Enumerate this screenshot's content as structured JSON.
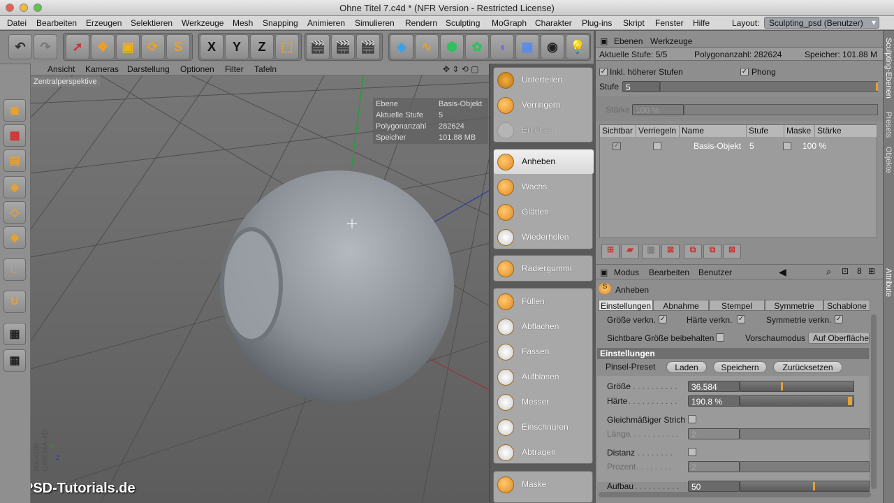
{
  "window": {
    "title": "Ohne Titel 7.c4d * (NFR Version - Restricted License)"
  },
  "menu": [
    "Datei",
    "Bearbeiten",
    "Erzeugen",
    "Selektieren",
    "Werkzeuge",
    "Mesh",
    "Snapping",
    "Animieren",
    "Simulieren",
    "Rendern",
    "Sculpting",
    "MoGraph",
    "Charakter",
    "Plug-ins",
    "Skript",
    "Fenster",
    "Hilfe"
  ],
  "layout": {
    "label": "Layout:",
    "value": "Sculpting_psd (Benutzer)"
  },
  "toolbar": {
    "x": "X",
    "y": "Y",
    "z": "Z"
  },
  "viewport": {
    "menu": [
      "Ansicht",
      "Kameras",
      "Darstellung",
      "Optionen",
      "Filter",
      "Tafeln"
    ],
    "camera": "Zentralperspektive",
    "hud": [
      {
        "k": "Ebene",
        "v": "Basis-Objekt"
      },
      {
        "k": "Aktuelle Stufe",
        "v": "5"
      },
      {
        "k": "Polygonanzahl",
        "v": "282624"
      },
      {
        "k": "Speicher",
        "v": "101.88 MB"
      }
    ],
    "watermark": "PSD-Tutorials.de",
    "brand": "MAXON CINEMA 4D",
    "axis_y": "Y",
    "axis_z": "Z"
  },
  "brushes": {
    "group1": [
      "Unterteilen",
      "Verringern",
      "Erhöhen"
    ],
    "group2": [
      "Anheben",
      "Wachs",
      "Glätten",
      "Wiederholen"
    ],
    "group3": [
      "Radiergummi"
    ],
    "group4": [
      "Füllen",
      "Abflachen",
      "Fassen",
      "Aufblasen",
      "Messer",
      "Einschnüren",
      "Abtragen"
    ],
    "group5": [
      "Maske"
    ]
  },
  "layers": {
    "tabs": [
      "Ebenen",
      "Werkzeuge"
    ],
    "info": {
      "stufe": "Aktuelle Stufe: 5/5",
      "poly": "Polygonanzahl: 282624",
      "mem": "Speicher: 101.88 M"
    },
    "incl": "Inkl. höherer Stufen",
    "phong": "Phong",
    "stufe_label": "Stufe",
    "stufe_value": "5",
    "staerke_label": "Stärke",
    "staerke_value": "100 %",
    "columns": [
      "Sichtbar",
      "Verriegeln",
      "Name",
      "Stufe",
      "Maske",
      "Stärke"
    ],
    "row": {
      "name": "Basis-Objekt",
      "stufe": "5",
      "staerke": "100 %"
    }
  },
  "attr": {
    "menu": [
      "Modus",
      "Bearbeiten",
      "Benutzer"
    ],
    "tool": "Anheben",
    "tabs": [
      "Einstellungen",
      "Abnahme",
      "Stempel",
      "Symmetrie",
      "Schablone"
    ],
    "opt1": "Größe verkn.",
    "opt2": "Härte verkn.",
    "opt3": "Symmetrie verkn.",
    "opt4": "Sichtbare Größe beibehalten",
    "preview_label": "Vorschaumodus",
    "preview_value": "Auf Oberfläche",
    "section": "Einstellungen",
    "preset_label": "Pinsel-Preset",
    "btn_load": "Laden",
    "btn_save": "Speichern",
    "btn_reset": "Zurücksetzen",
    "size_label": "Größe",
    "size_value": "36.584",
    "hard_label": "Härte",
    "hard_value": "190.8 %",
    "even_label": "Gleichmäßiger Strich",
    "len_label": "Länge",
    "len_value": "2",
    "dist_label": "Distanz",
    "pct_label": "Prozent",
    "pct_value": "2",
    "build_label": "Aufbau",
    "build_value": "50"
  },
  "side_tabs": [
    "Sculpting-Ebenen",
    "Presets",
    "Objekte",
    "Attribute"
  ]
}
